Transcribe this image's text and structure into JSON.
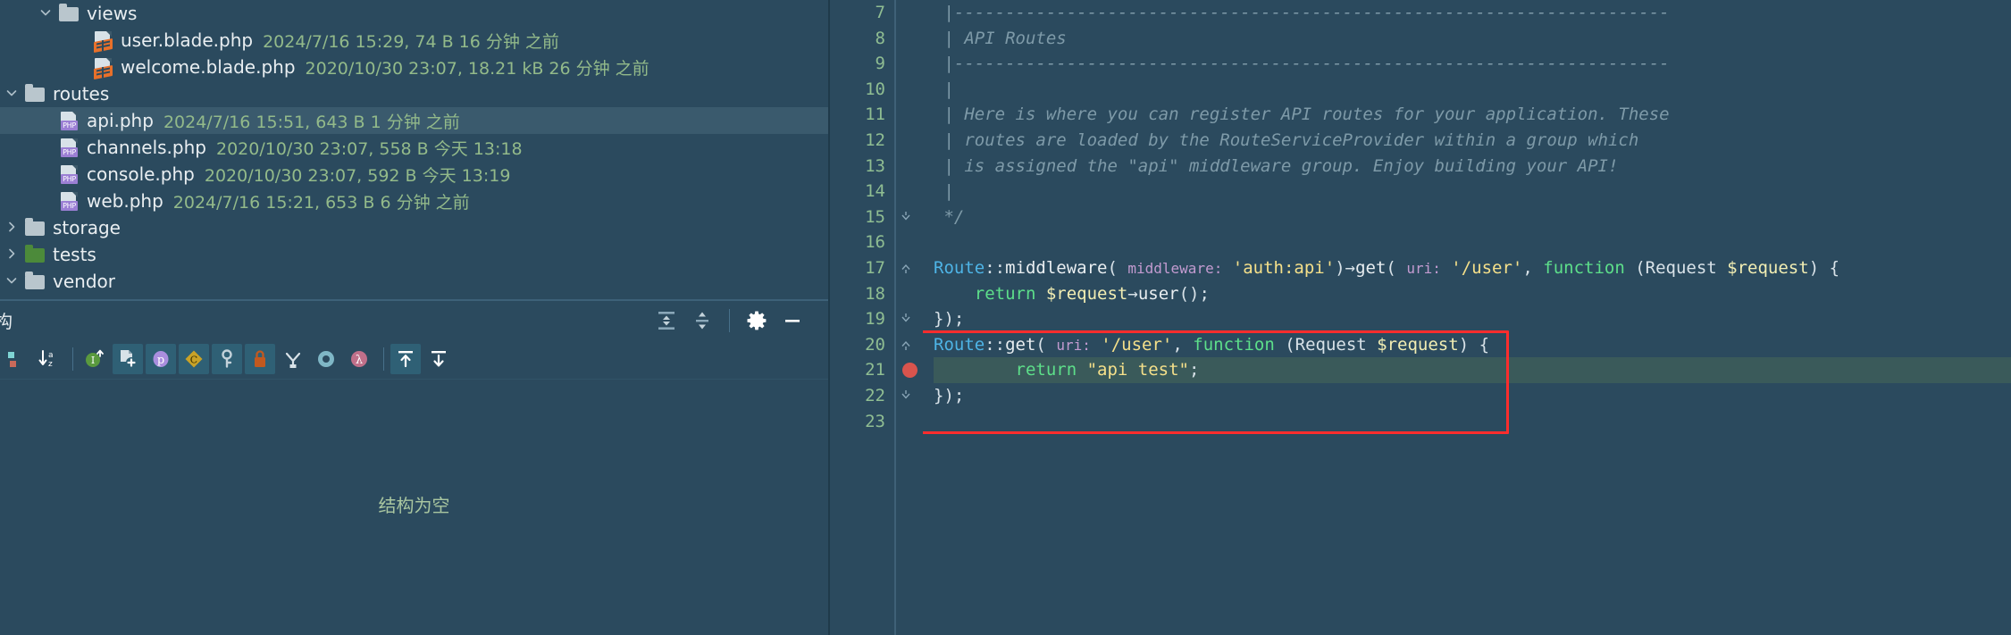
{
  "project_tree": {
    "rows": [
      {
        "indent": 1,
        "arrow": "chevron-down",
        "icon": "folder",
        "icon_color": "#b9c6cd",
        "label": "views",
        "meta": "",
        "selected": false
      },
      {
        "indent": 2,
        "arrow": "",
        "icon": "blade-file",
        "label": "user.blade.php",
        "meta": "2024/7/16 15:29, 74 B 16 分钟 之前",
        "selected": false
      },
      {
        "indent": 2,
        "arrow": "",
        "icon": "blade-file",
        "label": "welcome.blade.php",
        "meta": "2020/10/30 23:07, 18.21 kB 26 分钟 之前",
        "selected": false
      },
      {
        "indent": 0,
        "arrow": "chevron-down",
        "icon": "folder",
        "icon_color": "#b9c6cd",
        "label": "routes",
        "meta": "",
        "selected": false
      },
      {
        "indent": 1,
        "arrow": "",
        "icon": "php-file",
        "label": "api.php",
        "meta": "2024/7/16 15:51, 643 B 1 分钟 之前",
        "selected": true
      },
      {
        "indent": 1,
        "arrow": "",
        "icon": "php-file",
        "label": "channels.php",
        "meta": "2020/10/30 23:07, 558 B 今天 13:18",
        "selected": false
      },
      {
        "indent": 1,
        "arrow": "",
        "icon": "php-file",
        "label": "console.php",
        "meta": "2020/10/30 23:07, 592 B 今天 13:19",
        "selected": false
      },
      {
        "indent": 1,
        "arrow": "",
        "icon": "php-file",
        "label": "web.php",
        "meta": "2024/7/16 15:21, 653 B 6 分钟 之前",
        "selected": false
      },
      {
        "indent": 0,
        "arrow": "chevron-right",
        "icon": "folder",
        "icon_color": "#b9c6cd",
        "label": "storage",
        "meta": "",
        "selected": false
      },
      {
        "indent": 0,
        "arrow": "chevron-right",
        "icon": "folder",
        "icon_color": "#4c8a3a",
        "label": "tests",
        "meta": "",
        "selected": false
      },
      {
        "indent": 0,
        "arrow": "chevron-down",
        "icon": "folder",
        "icon_color": "#b9c6cd",
        "label": "vendor",
        "meta": "",
        "selected": false
      }
    ]
  },
  "structure_panel": {
    "title": "构",
    "empty_text": "结构为空",
    "header_actions": [
      {
        "name": "expand-all-icon",
        "glyph": "expand"
      },
      {
        "name": "collapse-all-icon",
        "glyph": "collapse"
      },
      {
        "name": "settings-gear-icon",
        "glyph": "gear"
      },
      {
        "name": "hide-panel-icon",
        "glyph": "minus"
      }
    ],
    "toolbar_buttons": [
      {
        "name": "sort-by-visibility-icon",
        "glyph": "vis",
        "active": false
      },
      {
        "name": "sort-alphabetically-icon",
        "glyph": "az",
        "active": false
      },
      {
        "name": "show-inherited-members-icon",
        "glyph": "inherited",
        "active": false
      },
      {
        "name": "show-anonymous-classes-icon",
        "glyph": "anon",
        "active": true
      },
      {
        "name": "show-properties-icon",
        "glyph": "p",
        "active": true
      },
      {
        "name": "show-constants-icon",
        "glyph": "c",
        "active": true
      },
      {
        "name": "show-fields-icon",
        "glyph": "key",
        "active": true
      },
      {
        "name": "show-non-public-icon",
        "glyph": "lock",
        "active": true
      },
      {
        "name": "show-inherited-tree-icon",
        "glyph": "tree",
        "active": false
      },
      {
        "name": "show-interfaces-icon",
        "glyph": "ring",
        "active": false
      },
      {
        "name": "show-lambdas-icon",
        "glyph": "lambda",
        "active": false
      },
      {
        "name": "expand-all-nodes-icon",
        "glyph": "expand-all",
        "active": true
      },
      {
        "name": "collapse-all-nodes-icon",
        "glyph": "collapse-all",
        "active": false
      }
    ]
  },
  "editor": {
    "first_line_number": 7,
    "caret_line_number": 21,
    "breakpoint_line": 21,
    "highlight_box": {
      "from_line": 20,
      "to_line": 23,
      "color": "#ff2d2d"
    },
    "lines": [
      {
        "n": 7,
        "fold": "",
        "tokens": [
          {
            "t": " |----------------------------------------------------------------------",
            "c": "cmt"
          }
        ]
      },
      {
        "n": 8,
        "fold": "",
        "tokens": [
          {
            "t": " | API Routes",
            "c": "cmt"
          }
        ]
      },
      {
        "n": 9,
        "fold": "",
        "tokens": [
          {
            "t": " |----------------------------------------------------------------------",
            "c": "cmt"
          }
        ]
      },
      {
        "n": 10,
        "fold": "",
        "tokens": [
          {
            "t": " |",
            "c": "cmt"
          }
        ]
      },
      {
        "n": 11,
        "fold": "",
        "tokens": [
          {
            "t": " | Here is where you can register API routes for your application. These",
            "c": "cmt"
          }
        ]
      },
      {
        "n": 12,
        "fold": "",
        "tokens": [
          {
            "t": " | routes are loaded by the RouteServiceProvider within a group which",
            "c": "cmt"
          }
        ]
      },
      {
        "n": 13,
        "fold": "",
        "tokens": [
          {
            "t": " | is assigned the \"api\" middleware group. Enjoy building your API!",
            "c": "cmt"
          }
        ]
      },
      {
        "n": 14,
        "fold": "",
        "tokens": [
          {
            "t": " |",
            "c": "cmt"
          }
        ]
      },
      {
        "n": 15,
        "fold": "fold-end",
        "tokens": [
          {
            "t": " */",
            "c": "cmt"
          }
        ]
      },
      {
        "n": 16,
        "fold": "",
        "tokens": []
      },
      {
        "n": 17,
        "fold": "fold-start",
        "tokens": [
          {
            "t": "Route",
            "c": "kw"
          },
          {
            "t": "::",
            "c": "pun"
          },
          {
            "t": "middleware",
            "c": "meth"
          },
          {
            "t": "( ",
            "c": "pun"
          },
          {
            "t": "middleware:",
            "c": "hint"
          },
          {
            "t": " ",
            "c": "pun"
          },
          {
            "t": "'auth:api'",
            "c": "str"
          },
          {
            "t": ")",
            "c": "pun"
          },
          {
            "t": "→",
            "c": "pun"
          },
          {
            "t": "get",
            "c": "meth"
          },
          {
            "t": "( ",
            "c": "pun"
          },
          {
            "t": "uri:",
            "c": "hint"
          },
          {
            "t": " ",
            "c": "pun"
          },
          {
            "t": "'/user'",
            "c": "str"
          },
          {
            "t": ", ",
            "c": "pun"
          },
          {
            "t": "function",
            "c": "kw2"
          },
          {
            "t": " (Request ",
            "c": "pun"
          },
          {
            "t": "$request",
            "c": "var"
          },
          {
            "t": ") {",
            "c": "pun"
          }
        ]
      },
      {
        "n": 18,
        "fold": "",
        "tokens": [
          {
            "t": "    ",
            "c": "pun"
          },
          {
            "t": "return",
            "c": "kw2"
          },
          {
            "t": " ",
            "c": "pun"
          },
          {
            "t": "$request",
            "c": "var"
          },
          {
            "t": "→",
            "c": "pun"
          },
          {
            "t": "user",
            "c": "meth"
          },
          {
            "t": "();",
            "c": "pun"
          }
        ]
      },
      {
        "n": 19,
        "fold": "fold-end",
        "tokens": [
          {
            "t": "});",
            "c": "pun"
          }
        ]
      },
      {
        "n": 20,
        "fold": "fold-start",
        "tokens": [
          {
            "t": "Route",
            "c": "kw"
          },
          {
            "t": "::",
            "c": "pun"
          },
          {
            "t": "get",
            "c": "meth"
          },
          {
            "t": "( ",
            "c": "pun"
          },
          {
            "t": "uri:",
            "c": "hint"
          },
          {
            "t": " ",
            "c": "pun"
          },
          {
            "t": "'/user'",
            "c": "str"
          },
          {
            "t": ", ",
            "c": "pun"
          },
          {
            "t": "function",
            "c": "kw2"
          },
          {
            "t": " (Request ",
            "c": "pun"
          },
          {
            "t": "$request",
            "c": "var"
          },
          {
            "t": ") {",
            "c": "pun"
          }
        ]
      },
      {
        "n": 21,
        "fold": "",
        "tokens": [
          {
            "t": "        ",
            "c": "pun"
          },
          {
            "t": "return",
            "c": "kw2"
          },
          {
            "t": " ",
            "c": "pun"
          },
          {
            "t": "\"api test\"",
            "c": "str"
          },
          {
            "t": ";",
            "c": "pun"
          }
        ]
      },
      {
        "n": 22,
        "fold": "fold-end",
        "tokens": [
          {
            "t": "});",
            "c": "pun"
          }
        ]
      },
      {
        "n": 23,
        "fold": "",
        "tokens": []
      }
    ]
  },
  "colors": {
    "background": "#2b4a5e",
    "selection": "#3a5a6d",
    "caret_line": "#3a5a5a",
    "accent_red": "#ff2d2d",
    "meta_text": "#93ba8a",
    "gutter_number": "#8fbd92"
  }
}
